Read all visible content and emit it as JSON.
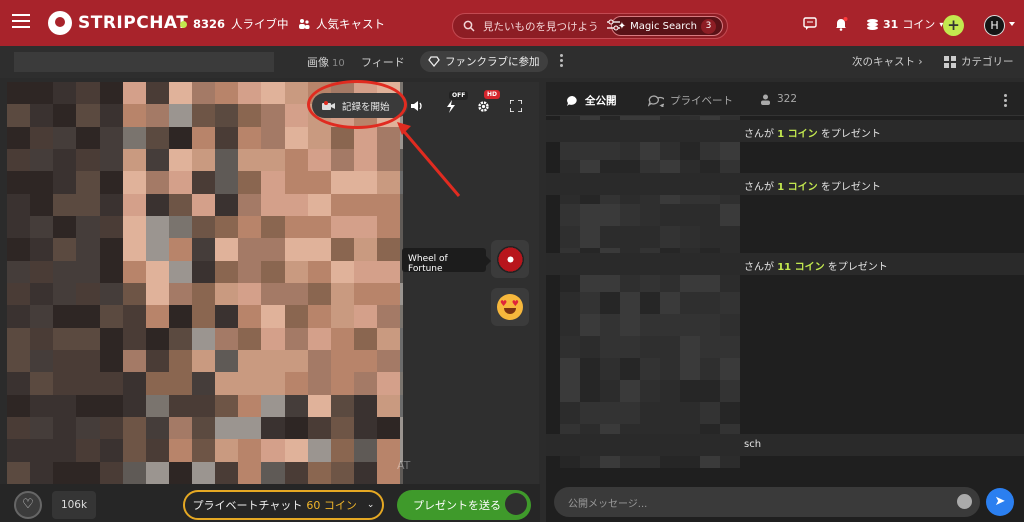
{
  "header": {
    "logo_text": "STRIPCHAT",
    "live_count": "8326",
    "live_label": "人ライブ中",
    "popular_label": "人気キャスト",
    "search_placeholder": "見たいものを見つけよう",
    "magic_search_label": "Magic Search",
    "magic_search_count": "3",
    "coins_amount": "31",
    "coins_label": "コイン",
    "avatar_letter": "H"
  },
  "subbar": {
    "tab_images": "画像",
    "tab_images_count": "10",
    "tab_feed": "フィード",
    "fanclub_label": "ファンクラブに参加",
    "next_cast": "次のキャスト",
    "category": "カテゴリー"
  },
  "video": {
    "record_label": "記録を開始",
    "badge_off": "OFF",
    "badge_hd": "HD",
    "wheel_tooltip": "Wheel of Fortune",
    "watermark": "AT",
    "likes": "106k",
    "private_chat_label": "プライベートチャット",
    "private_chat_price": "60 コイン",
    "gift_label": "プレゼントを送る"
  },
  "chat": {
    "tab_public": "全公開",
    "tab_private": "プライベート",
    "viewers": "322",
    "messages": [
      {
        "pre": "さんが ",
        "amount": "1 コイン",
        "post": " をプレゼント"
      },
      {
        "pre": "さんが ",
        "amount": "1 コイン",
        "post": " をプレゼント"
      },
      {
        "pre": "さんが ",
        "amount": "11 コイン",
        "post": " をプレゼント"
      }
    ],
    "partial_text": "sch",
    "input_placeholder": "公開メッセージ..."
  },
  "colors": {
    "brand": "#a8232b",
    "accent_green": "#c3e84f",
    "gift_green": "#3f9a2b",
    "gold": "#f0b52a",
    "annotation_red": "#e02b20"
  }
}
